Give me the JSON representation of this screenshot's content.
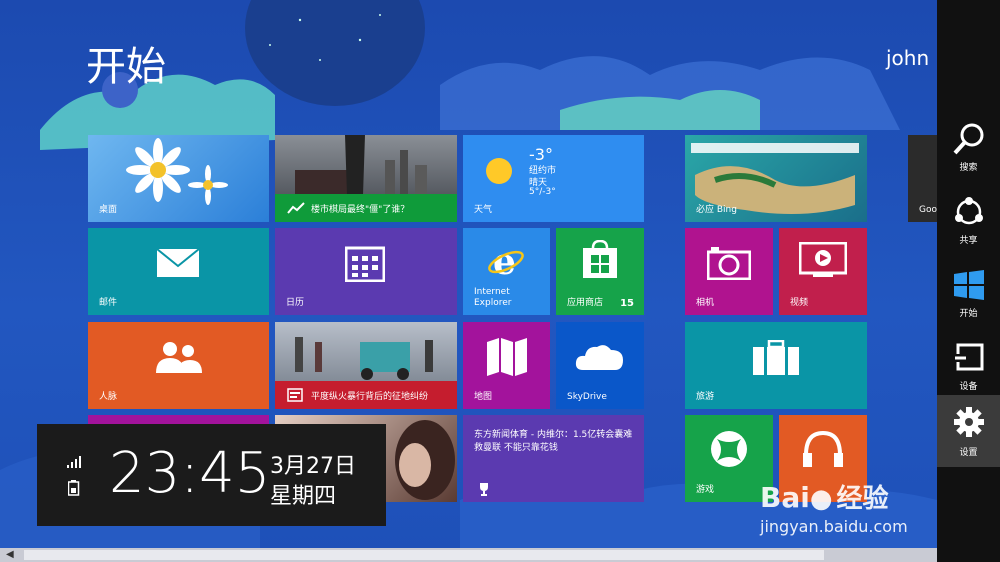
{
  "header": {
    "title": "开始",
    "user": "john"
  },
  "tiles": {
    "desktop": {
      "label": "桌面"
    },
    "news": {
      "label": "楼市棋局最终\"僵\"了谁？"
    },
    "weather": {
      "label": "天气",
      "temp": "-3°",
      "city": "纽约市",
      "condition": "晴天",
      "range": "5°/-3°"
    },
    "bing": {
      "label": "必应 Bing"
    },
    "google_partial": {
      "label": "Goo"
    },
    "mail": {
      "label": "邮件"
    },
    "calendar": {
      "label": "日历"
    },
    "ie": {
      "label": "Internet\nExplorer"
    },
    "store": {
      "label": "应用商店",
      "badge": "15"
    },
    "camera": {
      "label": "相机"
    },
    "video": {
      "label": "视频"
    },
    "people": {
      "label": "人脉"
    },
    "news2": {
      "label": "平度纵火暴行背后的征地纠纷"
    },
    "maps": {
      "label": "地图"
    },
    "skydrive": {
      "label": "SkyDrive"
    },
    "travel": {
      "label": "旅游"
    },
    "sports": {
      "text": "东方新闻体育 - 内维尔：1.5亿转会囊难救曼联 不能只靠花钱"
    },
    "games": {
      "label": "游戏"
    }
  },
  "charms": [
    {
      "label": "搜索",
      "icon": "search-icon"
    },
    {
      "label": "共享",
      "icon": "share-icon"
    },
    {
      "label": "开始",
      "icon": "windows-icon"
    },
    {
      "label": "设备",
      "icon": "devices-icon"
    },
    {
      "label": "设置",
      "icon": "gear-icon"
    }
  ],
  "clock": {
    "time": "23:45",
    "date": "3月27日",
    "weekday": "星期四"
  },
  "watermark": {
    "brand": "Bai",
    "brand2": "经验",
    "url": "jingyan.baidu.com"
  },
  "colors": {
    "teal": "#0a95a6",
    "purple": "#5b3ab0",
    "blue": "#2a8ae8",
    "green": "#16a34a",
    "magenta": "#b0138f",
    "crimson": "#c11f4c",
    "orange": "#e25a24",
    "charms_bg": "#111111"
  }
}
